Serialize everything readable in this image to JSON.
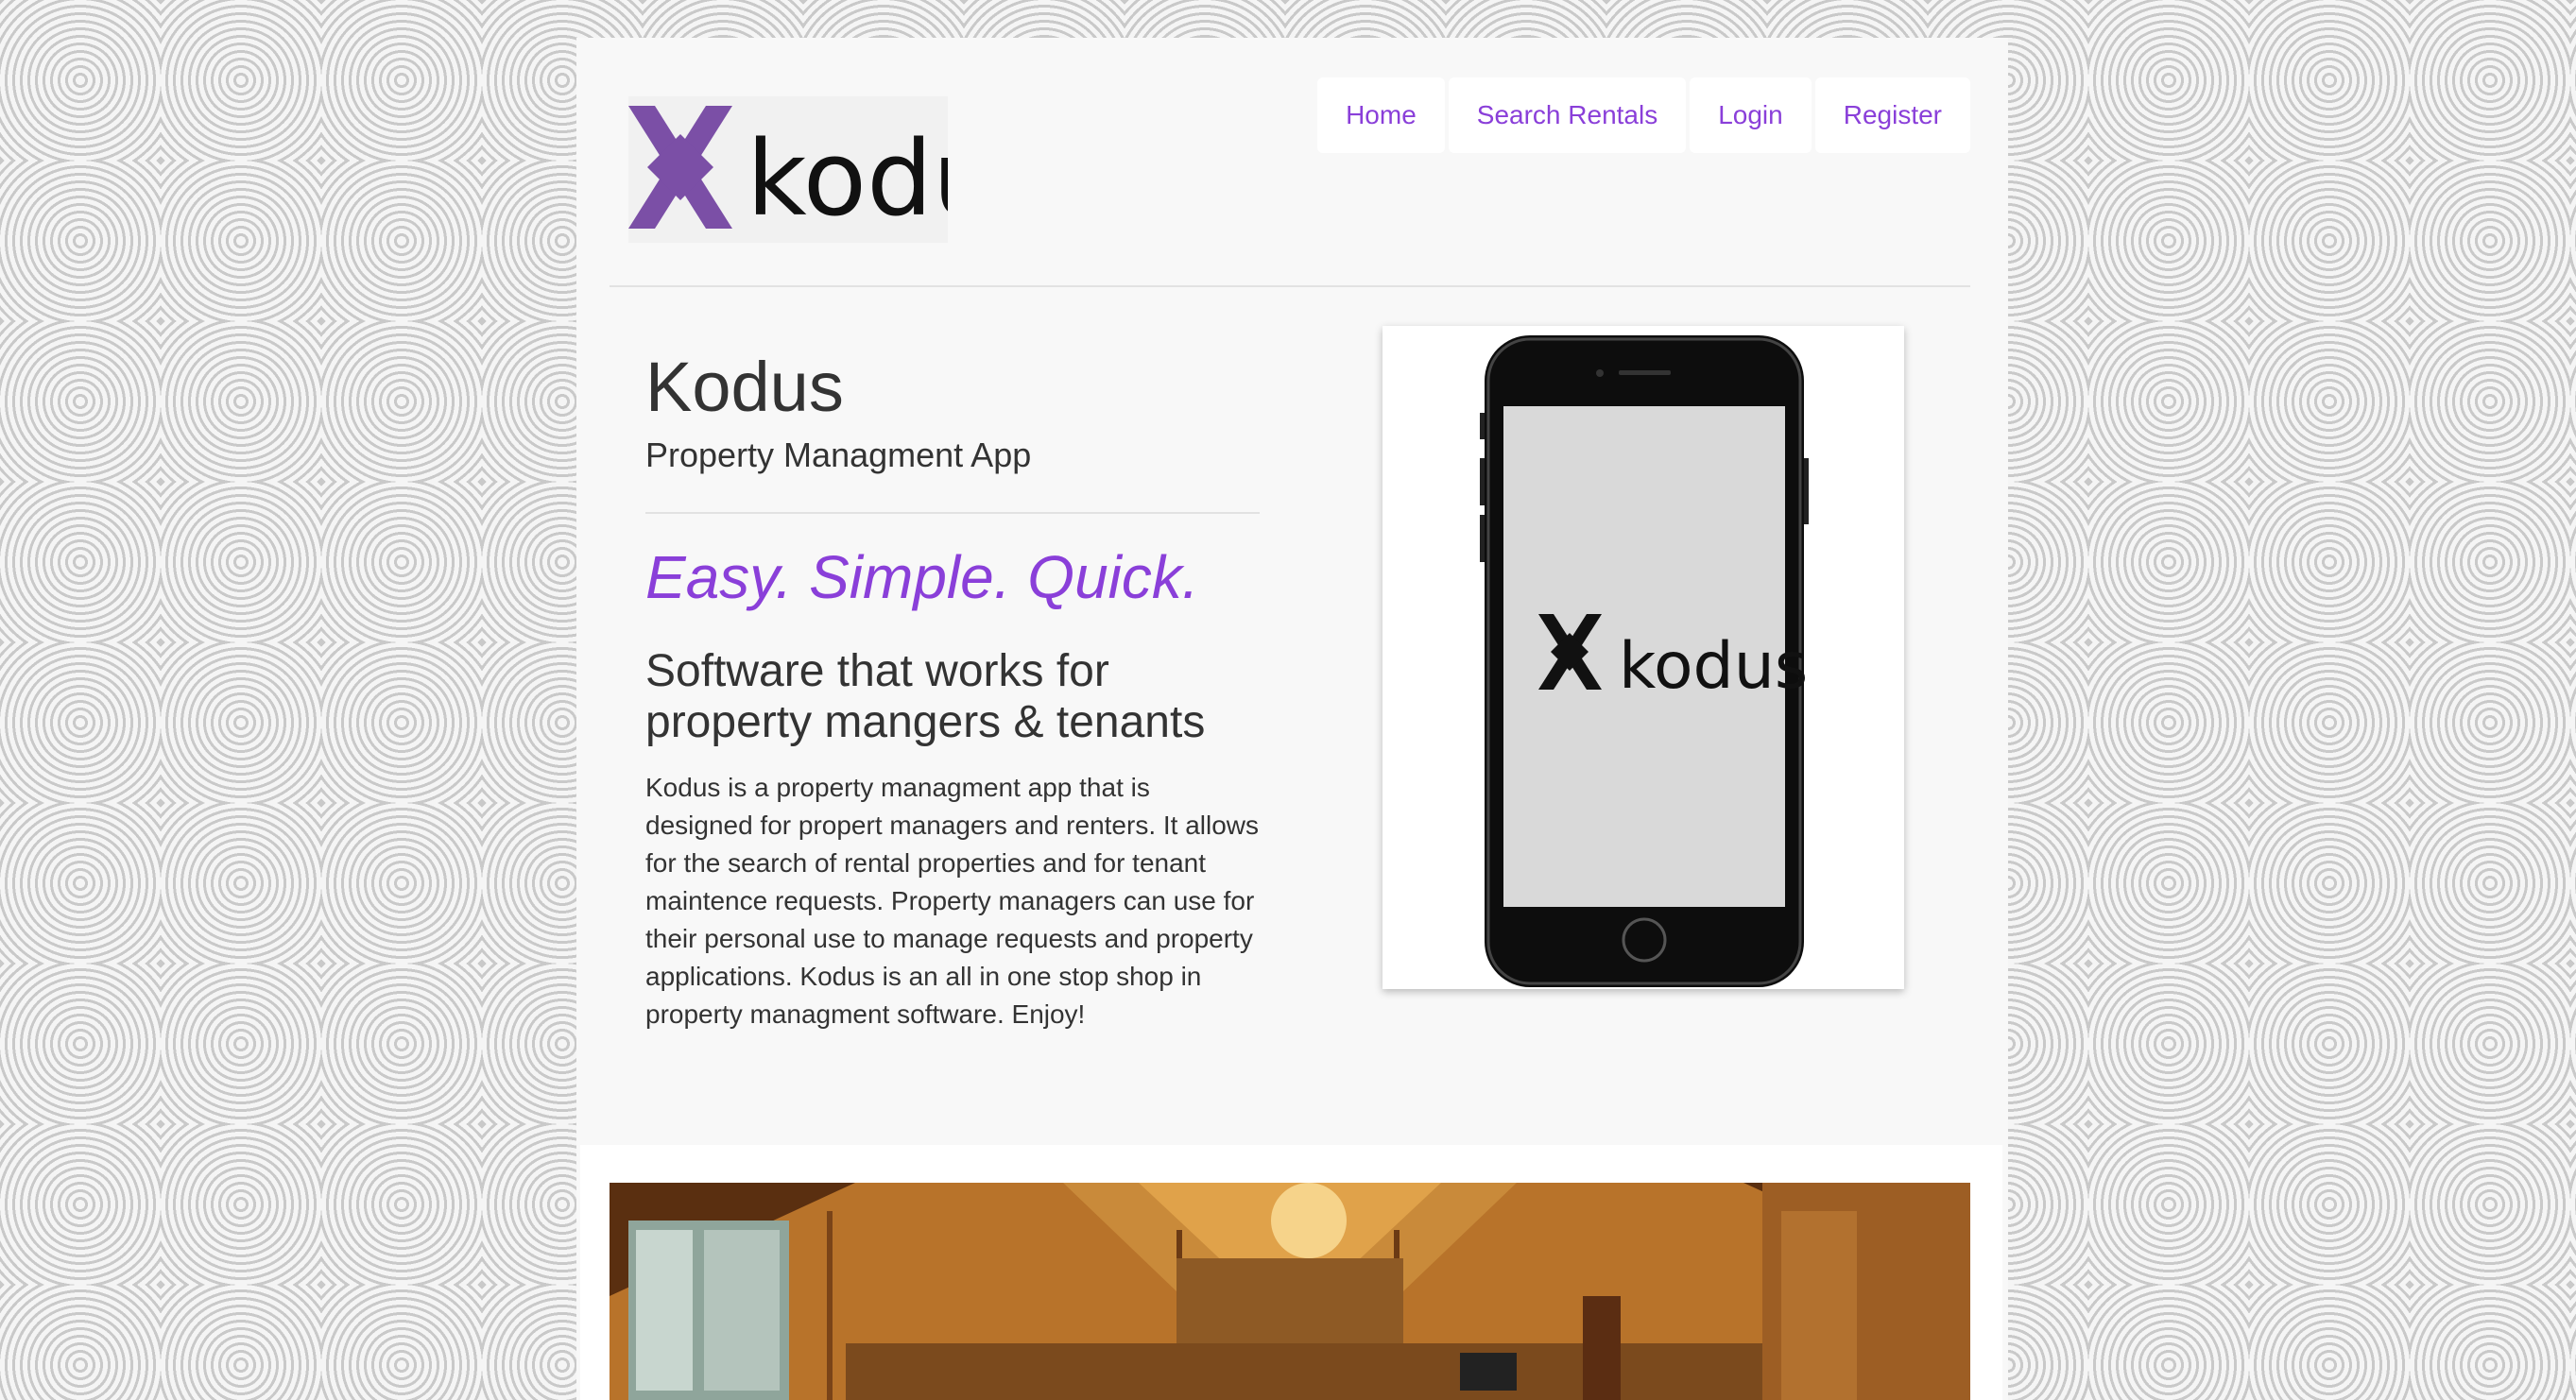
{
  "logo": {
    "text": "kodus",
    "accent_color": "#7b4fa6"
  },
  "nav": {
    "items": [
      {
        "label": "Home"
      },
      {
        "label": "Search Rentals"
      },
      {
        "label": "Login"
      },
      {
        "label": "Register"
      }
    ],
    "link_color": "#8a3fd9"
  },
  "intro": {
    "title": "Kodus",
    "subtitle": "Property Managment App",
    "tagline": "Easy. Simple. Quick.",
    "heading_line1": "Software that works for",
    "heading_line2": "property mangers & tenants",
    "description": "Kodus is a property managment app that is designed for propert managers and renters. It allows for the search of rental properties and for tenant maintence requests. Property managers can use for their personal use to manage requests and property applications. Kodus is an all in one stop shop in property managment software. Enjoy!"
  },
  "phone": {
    "screen_logo_text": "kodus"
  }
}
